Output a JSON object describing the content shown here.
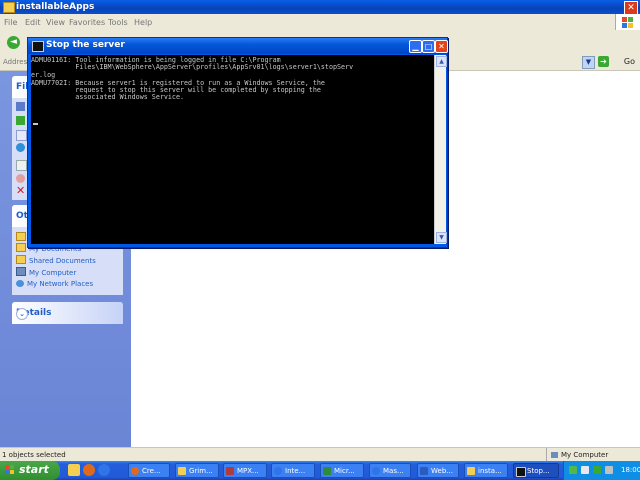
{
  "explorer": {
    "title": "installableApps",
    "menu": [
      "File",
      "Edit",
      "View",
      "Favorites",
      "Tools",
      "Help"
    ],
    "address_label": "Address",
    "go_label": "Go",
    "file_tasks_header": "File",
    "other_places_header": "Oth",
    "other_places": [
      "My Documents",
      "Shared Documents",
      "My Computer",
      "My Network Places"
    ],
    "details_header": "Details",
    "status_left": "1 objects selected",
    "status_right": "My Computer"
  },
  "console_window": {
    "title": "Stop the server",
    "lines": [
      "ADMU0116I: Tool information is being logged in file C:\\Program",
      "           Files\\IBM\\WebSphere\\AppServer\\profiles\\AppSrv01\\logs\\server1\\stopServ",
      "er.log",
      "ADMU7702I: Because server1 is registered to run as a Windows Service, the",
      "           request to stop this server will be completed by stopping the",
      "           associated Windows Service."
    ]
  },
  "taskbar": {
    "start_label": "start",
    "tasks": [
      "Cre...",
      "Grim...",
      "MPX...",
      "Inte...",
      "Micr...",
      "Mas...",
      "Web...",
      "insta...",
      "Stop..."
    ],
    "clock": "18:00PM"
  },
  "colors": {
    "title_blue": "#0a5ee8",
    "console_bg": "#000000",
    "console_text": "#c8c8c8",
    "taskbar_blue": "#245edb",
    "start_green": "#3a9a3a"
  }
}
